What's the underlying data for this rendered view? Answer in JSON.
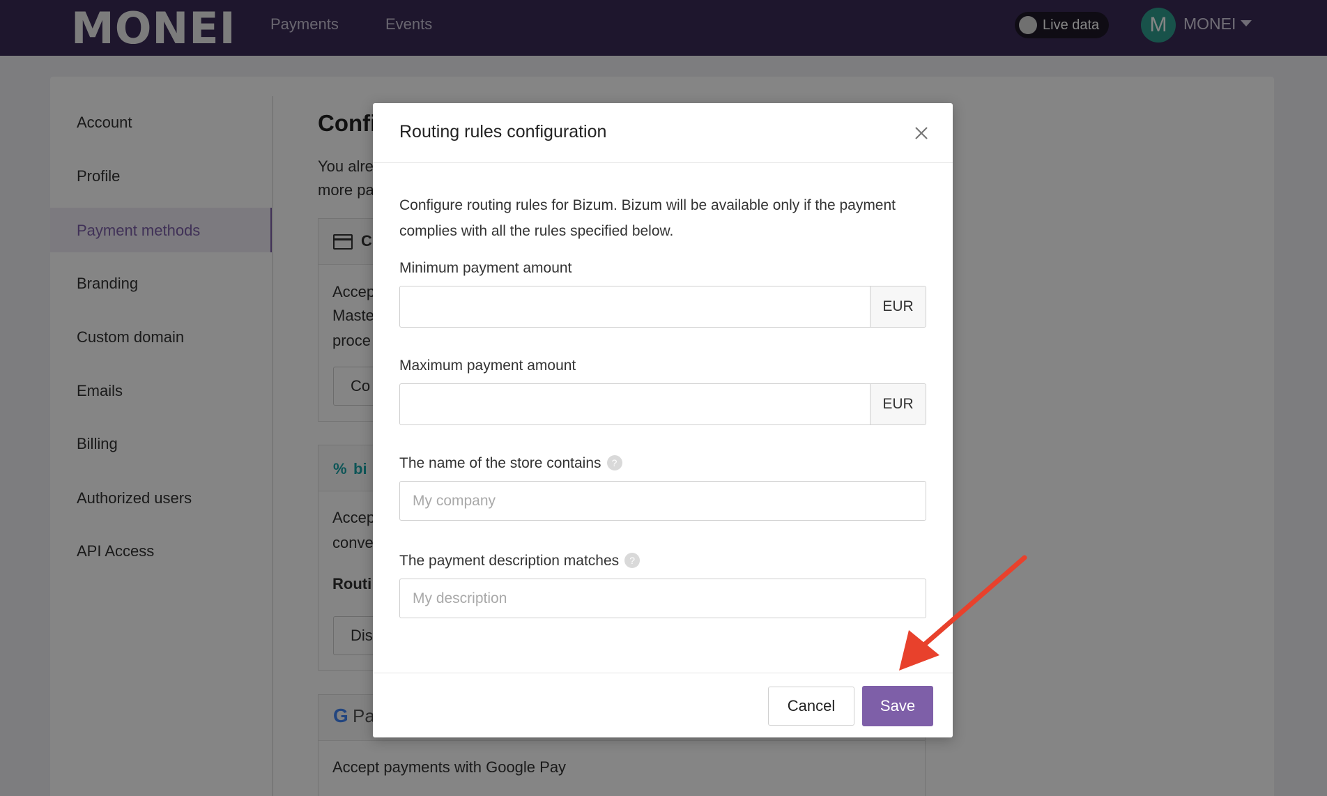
{
  "app": {
    "logo": "MONEI",
    "nav": [
      "Payments",
      "Events"
    ],
    "live_toggle_label": "Live data",
    "avatar_initial": "M",
    "user_name": "MONEI"
  },
  "sidebar": {
    "items": [
      "Account",
      "Profile",
      "Payment methods",
      "Branding",
      "Custom domain",
      "Emails",
      "Billing",
      "Authorized users",
      "API Access"
    ],
    "active": "Payment methods"
  },
  "background": {
    "title_partial": "Confi",
    "intro_line1_partial": "You alre",
    "intro_line2_partial": "more pa",
    "card_section": {
      "header_partial": "C",
      "text_lines_partial": [
        "Accep",
        "Maste",
        "proce"
      ],
      "button_partial": "Co"
    },
    "bizum_section": {
      "header_partial": "bi",
      "text_lines_partial": [
        "Accep",
        "conve"
      ],
      "routing_partial": "Routi",
      "button_partial": "Dis"
    },
    "google_pay_section": {
      "header_partial": "Pa",
      "text": "Accept payments with Google Pay"
    }
  },
  "modal": {
    "title": "Routing rules configuration",
    "description": "Configure routing rules for Bizum. Bizum will be available only if the payment complies with all the rules specified below.",
    "fields": {
      "min_amount": {
        "label": "Minimum payment amount",
        "value": "",
        "addon": "EUR"
      },
      "max_amount": {
        "label": "Maximum payment amount",
        "value": "",
        "addon": "EUR"
      },
      "store_name": {
        "label": "The name of the store contains",
        "placeholder": "My company",
        "value": ""
      },
      "description": {
        "label": "The payment description matches",
        "placeholder": "My description",
        "value": ""
      }
    },
    "cancel_label": "Cancel",
    "save_label": "Save"
  },
  "colors": {
    "topbar": "#3a2b56",
    "accent": "#7e5fa8",
    "annotation_arrow": "#e8412c"
  }
}
